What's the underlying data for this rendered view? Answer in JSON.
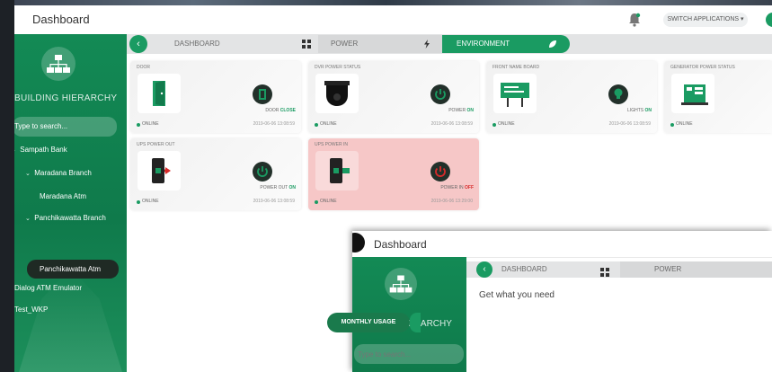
{
  "window": {
    "title": "Dashboard",
    "switch_applications": "SWITCH APPLICATIONS ▾"
  },
  "sidebar": {
    "hierarchy_label": "BUILDING HIERARCHY",
    "search_placeholder": "Type to search...",
    "tree": [
      {
        "label": "Sampath Bank",
        "level": 0,
        "expanded": true
      },
      {
        "label": "Maradana Branch",
        "level": 1,
        "expanded": true
      },
      {
        "label": "Maradana Atm",
        "level": 2
      },
      {
        "label": "Panchikawatta Branch",
        "level": 1,
        "expanded": true
      },
      {
        "label": "Panchikawatta Atm",
        "level": 2,
        "selected": true
      },
      {
        "label": "Dialog ATM Emulator",
        "level": 0
      },
      {
        "label": "Test_WKP",
        "level": 0
      }
    ]
  },
  "tabs": [
    {
      "label": "DASHBOARD",
      "icon": "grid-icon"
    },
    {
      "label": "POWER",
      "icon": "bolt-icon"
    },
    {
      "label": "ENVIRONMENT",
      "icon": "leaf-icon",
      "active": true
    }
  ],
  "cards": [
    {
      "title": "DOOR",
      "icon": "door-icon",
      "status_label": "DOOR",
      "status_value": "CLOSE",
      "online": "ONLINE",
      "time": "2019-06-06 13:08:59"
    },
    {
      "title": "DVR POWER STATUS",
      "icon": "camera-icon",
      "status_label": "POWER",
      "status_value": "ON",
      "online": "ONLINE",
      "time": "2019-06-06 13:08:59"
    },
    {
      "title": "FRONT NAME BOARD",
      "icon": "billboard-icon",
      "status_label": "LIGHTS",
      "status_value": "ON",
      "online": "ONLINE",
      "time": "2019-06-06 13:08:59"
    },
    {
      "title": "GENERATOR POWER STATUS",
      "icon": "generator-icon",
      "status_label": "",
      "status_value": "",
      "online": "ONLINE",
      "time": ""
    },
    {
      "title": "UPS POWER OUT",
      "icon": "ups-out-icon",
      "status_label": "POWER OUT",
      "status_value": "ON",
      "online": "ONLINE",
      "time": "2019-06-06 13:08:59"
    },
    {
      "title": "UPS POWER IN",
      "icon": "ups-in-icon",
      "status_label": "POWER IN",
      "status_value": "OFF",
      "online": "ONLINE",
      "time": "2019-06-06 13:29:00",
      "alert": true
    }
  ],
  "overlay": {
    "title": "Dashboard",
    "hierarchy_label": "BUILDING HIERARCHY",
    "search_placeholder": "Type to search...",
    "tabs": [
      {
        "label": "DASHBOARD",
        "icon": "grid-icon"
      },
      {
        "label": "POWER"
      }
    ],
    "heading": "Get what you need",
    "monthly_usage_button": "MONTHLY USAGE"
  },
  "colors": {
    "brand_green": "#1a9b62",
    "sidebar_green": "#138a55",
    "off_red": "#d62b2b",
    "alert_pink": "#f6c7c7"
  }
}
